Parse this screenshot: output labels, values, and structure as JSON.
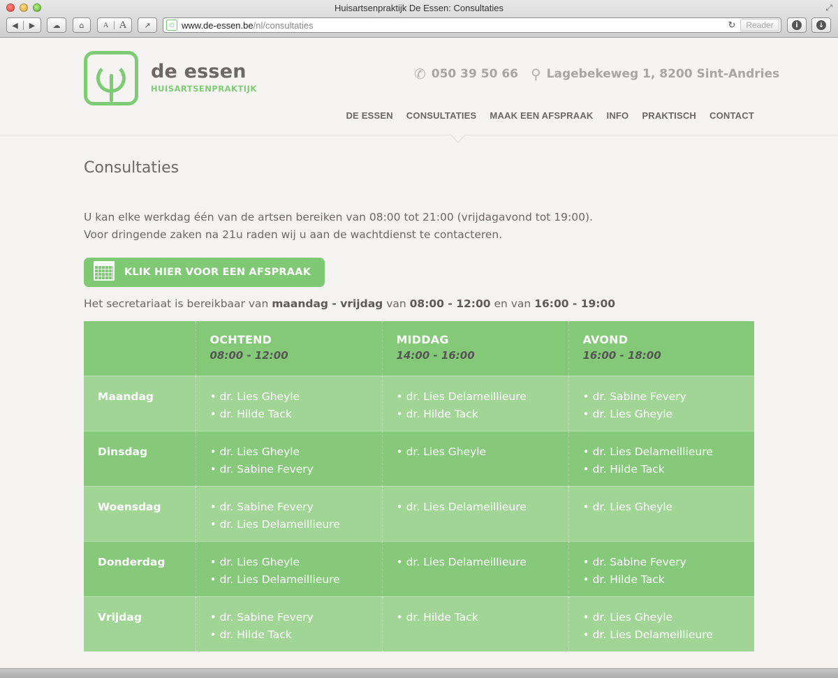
{
  "browser": {
    "window_title": "Huisartsenpraktijk De Essen: Consultaties",
    "url_host": "www.de-essen.be",
    "url_path": "/nl/consultaties",
    "reader_label": "Reader",
    "font_small": "A",
    "font_large": "A"
  },
  "header": {
    "logo_name": "de essen",
    "logo_sub": "HUISARTSENPRAKTIJK",
    "phone": "050 39 50 66",
    "address": "Lagebekeweg 1, 8200 Sint-Andries",
    "nav": [
      "DE ESSEN",
      "CONSULTATIES",
      "MAAK EEN AFSPRAAK",
      "INFO",
      "PRAKTISCH",
      "CONTACT"
    ],
    "active_nav": "CONSULTATIES"
  },
  "content": {
    "title": "Consultaties",
    "intro_line1": "U kan elke werkdag één van de artsen bereiken van 08:00 tot 21:00 (vrijdagavond tot 19:00).",
    "intro_line2": "Voor dringende zaken na 21u raden wij u aan de wachtdienst te contacteren.",
    "cta_label": "KLIK HIER VOOR EEN AFSPRAAK",
    "secret_prefix": "Het secretariaat is bereikbaar van ",
    "secret_days": "maandag - vrijdag",
    "secret_mid1": " van ",
    "secret_hours1": "08:00 - 12:00",
    "secret_mid2": " en van ",
    "secret_hours2": "16:00 - 19:00"
  },
  "schedule": {
    "slots": [
      {
        "name": "OCHTEND",
        "time": "08:00 - 12:00"
      },
      {
        "name": "MIDDAG",
        "time": "14:00 - 16:00"
      },
      {
        "name": "AVOND",
        "time": "16:00 - 18:00"
      }
    ],
    "days": [
      {
        "day": "Maandag",
        "cells": [
          [
            "dr. Lies Gheyle",
            "dr. Hilde Tack"
          ],
          [
            "dr. Lies Delameillieure",
            "dr. Hilde Tack"
          ],
          [
            "dr. Sabine Fevery",
            "dr. Lies Gheyle"
          ]
        ]
      },
      {
        "day": "Dinsdag",
        "cells": [
          [
            "dr. Lies Gheyle",
            "dr. Sabine Fevery"
          ],
          [
            "dr. Lies Gheyle"
          ],
          [
            "dr. Lies Delameillieure",
            "dr. Hilde Tack"
          ]
        ]
      },
      {
        "day": "Woensdag",
        "cells": [
          [
            "dr. Sabine Fevery",
            "dr. Lies Delameillieure"
          ],
          [
            "dr. Lies Delameillieure"
          ],
          [
            "dr. Lies Gheyle"
          ]
        ]
      },
      {
        "day": "Donderdag",
        "cells": [
          [
            "dr. Lies Gheyle",
            "dr. Lies Delameillieure"
          ],
          [
            "dr. Lies Delameillieure"
          ],
          [
            "dr. Sabine Fevery",
            "dr. Hilde Tack"
          ]
        ]
      },
      {
        "day": "Vrijdag",
        "cells": [
          [
            "dr. Sabine Fevery",
            "dr. Hilde Tack"
          ],
          [
            "dr. Hilde Tack"
          ],
          [
            "dr. Lies Gheyle",
            "dr. Lies Delameillieure"
          ]
        ]
      }
    ]
  },
  "colors": {
    "brand_green": "#7fcb75",
    "table_header": "#84c977",
    "row_light": "#a0d595",
    "row_dark": "#86c97a"
  },
  "icons": [
    "back-icon",
    "forward-icon",
    "cloud-icon",
    "home-icon",
    "share-icon",
    "reload-icon",
    "info-icon",
    "download-icon",
    "phone-icon",
    "location-pin-icon",
    "calendar-icon"
  ]
}
